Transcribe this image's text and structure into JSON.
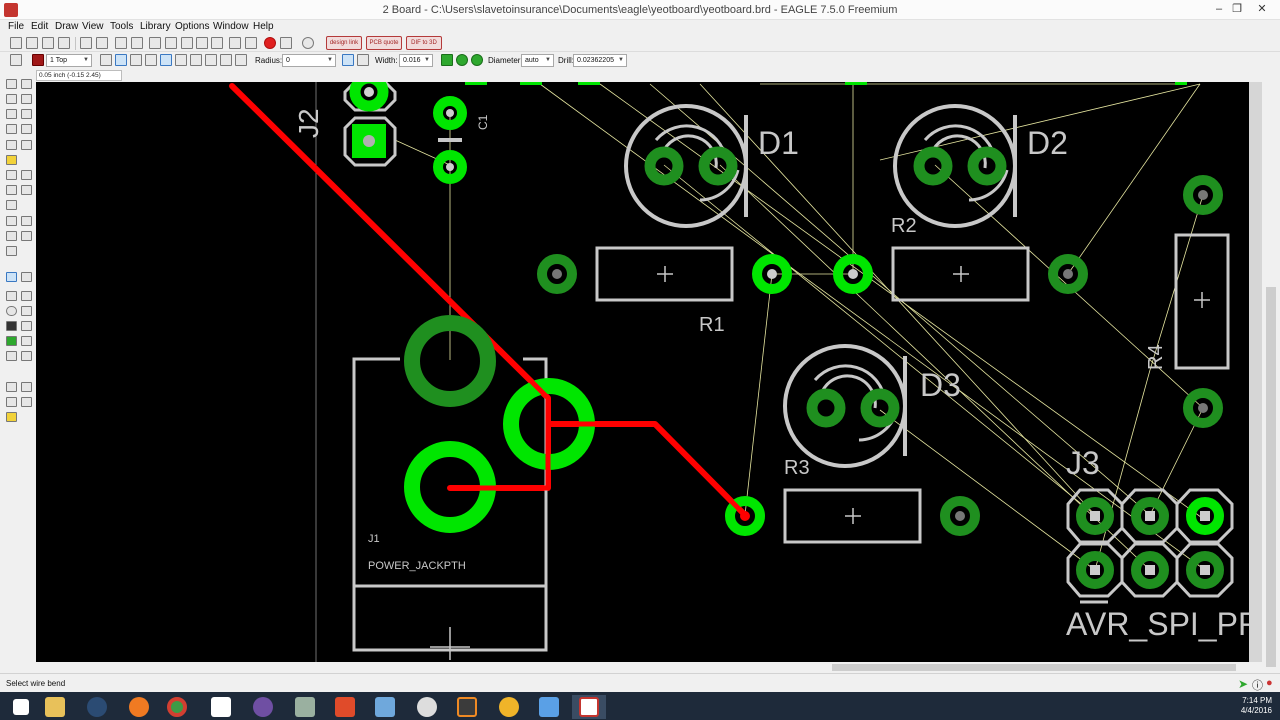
{
  "window": {
    "title": "2 Board - C:\\Users\\slavetoinsurance\\Documents\\eagle\\yeotboard\\yeotboard.brd - EAGLE 7.5.0 Freemium",
    "controls": [
      "minimize",
      "restore",
      "close"
    ]
  },
  "menu": [
    "File",
    "Edit",
    "Draw",
    "View",
    "Tools",
    "Library",
    "Options",
    "Window",
    "Help"
  ],
  "toolbar1": {
    "pills": [
      "design link",
      "PCB quote",
      "DIF to 3D"
    ]
  },
  "toolbar2": {
    "layer": "1 Top",
    "radius_label": "Radius:",
    "radius_value": "0",
    "width_label": "Width:",
    "width_value": "0.016",
    "diameter_label": "Diameter:",
    "diameter_value": "auto",
    "drill_label": "Drill:",
    "drill_value": "0.02362205"
  },
  "coordinates": "0.05 inch (-0.15 2.45)",
  "board": {
    "labels": {
      "j2": "J2",
      "c1": "C1",
      "d1": "D1",
      "d2": "D2",
      "d3": "D3",
      "r1": "R1",
      "r2": "R2",
      "r3": "R3",
      "r4": "R4",
      "j3": "J3",
      "j1": "J1",
      "j1_value": "POWER_JACKPTH",
      "j3_value": "AVR_SPI_PR"
    },
    "colors": {
      "background": "#000000",
      "pad_green": "#00e600",
      "pad_dark_green": "#1f8f1f",
      "trace_red": "#ff0000",
      "silk_gray": "#c8c8c8",
      "airwire": "#e6e6a0"
    }
  },
  "status": "Select wire bend",
  "taskbar": {
    "apps": [
      "file-explorer",
      "steam",
      "origin",
      "chrome",
      "twitch",
      "eclipse",
      "tool",
      "office",
      "app",
      "headphones",
      "sublime",
      "flower",
      "snow",
      "eagle"
    ],
    "active": "eagle",
    "time": "7:14 PM",
    "date": "4/4/2016"
  }
}
